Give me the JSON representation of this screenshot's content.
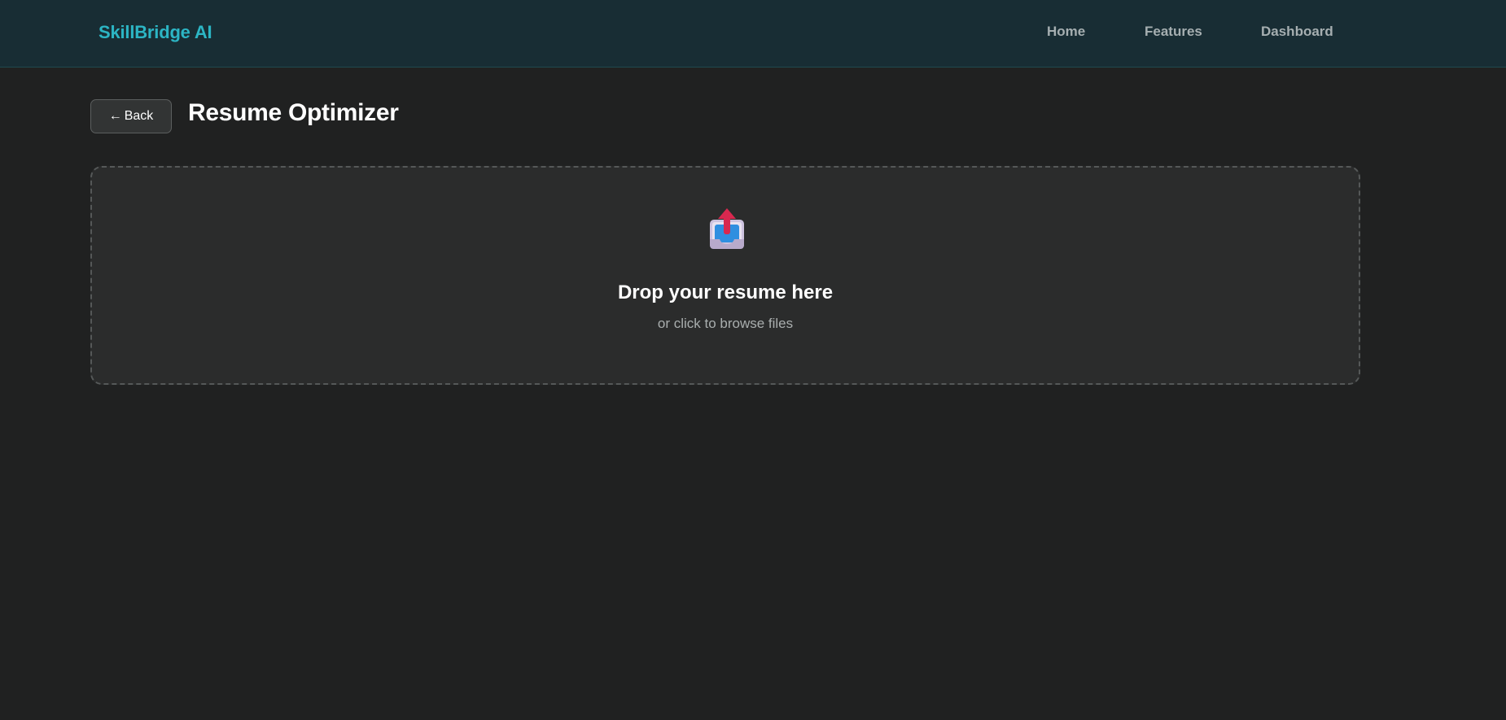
{
  "header": {
    "brand": "SkillBridge AI",
    "nav": {
      "home": "Home",
      "features": "Features",
      "dashboard": "Dashboard"
    }
  },
  "page": {
    "back_arrow": "←",
    "back_label": "Back",
    "title": "Resume Optimizer"
  },
  "upload": {
    "icon": "outbox-tray-icon",
    "title": "Drop your resume here",
    "subtitle": "or click to browse files"
  },
  "colors": {
    "background": "#202121",
    "header_bg": "#182d34",
    "brand": "#2cb5c4",
    "dropzone_bg": "#2b2c2c"
  }
}
